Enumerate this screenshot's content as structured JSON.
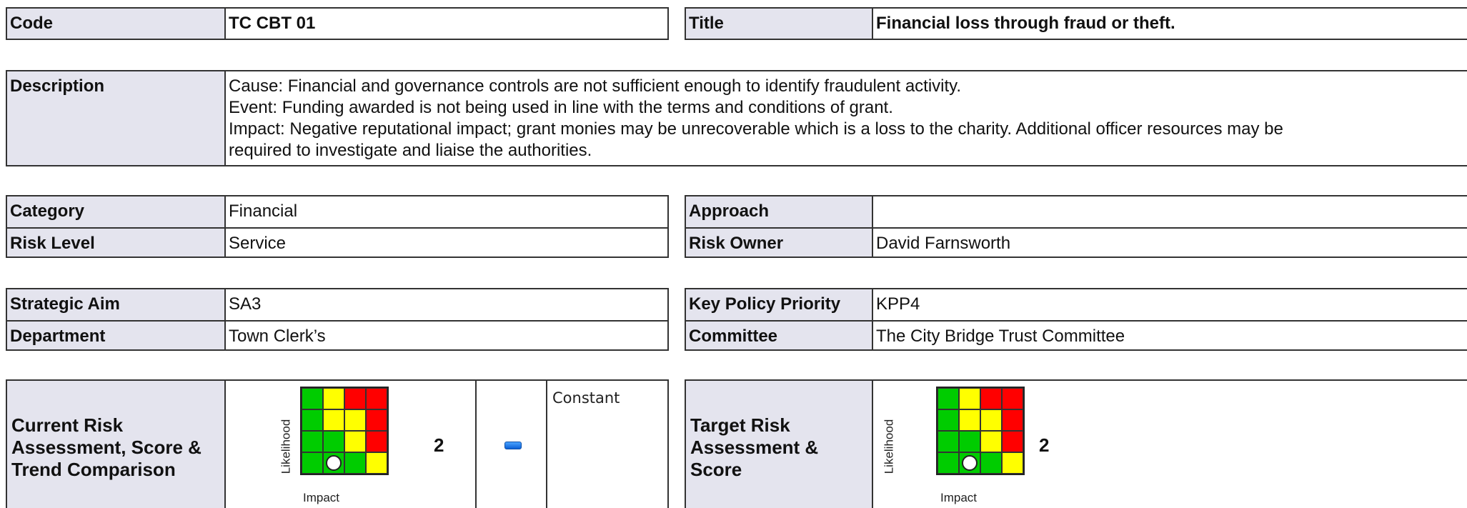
{
  "header": {
    "code_label": "Code",
    "code_value": "TC CBT 01",
    "title_label": "Title",
    "title_value": "Financial loss through fraud or theft."
  },
  "description": {
    "label": "Description",
    "lines": [
      "Cause: Financial and governance controls are not sufficient enough to identify fraudulent activity.",
      "Event: Funding awarded is not being used in line with the terms and conditions of grant.",
      "Impact: Negative reputational impact; grant monies may be unrecoverable which is a loss to the charity.  Additional officer resources may be",
      "required to investigate and liaise the authorities."
    ]
  },
  "classification": {
    "category_label": "Category",
    "category_value": "Financial",
    "risk_level_label": "Risk Level",
    "risk_level_value": "Service",
    "approach_label": "Approach",
    "approach_value": "",
    "risk_owner_label": "Risk Owner",
    "risk_owner_value": "David Farnsworth"
  },
  "alignment": {
    "strategic_aim_label": "Strategic Aim",
    "strategic_aim_value": "SA3",
    "department_label": "Department",
    "department_value": "Town Clerk’s",
    "kpp_label": "Key Policy Priority",
    "kpp_value": "KPP4",
    "committee_label": "Committee",
    "committee_value": "The City Bridge Trust Committee"
  },
  "current_assessment": {
    "label": "Current Risk Assessment, Score & Trend Comparison",
    "axis_y": "Likelihood",
    "axis_x": "Impact",
    "score": "2",
    "trend_icon": "dash-icon",
    "trend_text": "Constant",
    "marker_row": 4,
    "marker_col": 2
  },
  "target_assessment": {
    "label": "Target Risk Assessment & Score",
    "axis_y": "Likelihood",
    "axis_x": "Impact",
    "score": "2",
    "marker_row": 4,
    "marker_col": 2
  },
  "matrix_colors": [
    [
      "g",
      "y",
      "r",
      "r"
    ],
    [
      "g",
      "y",
      "y",
      "r"
    ],
    [
      "g",
      "g",
      "y",
      "r"
    ],
    [
      "g",
      "g",
      "g",
      "y"
    ]
  ],
  "colors": {
    "label_bg": "#e4e4ee",
    "green": "#00cc00",
    "yellow": "#ffff00",
    "red": "#ff0000"
  }
}
